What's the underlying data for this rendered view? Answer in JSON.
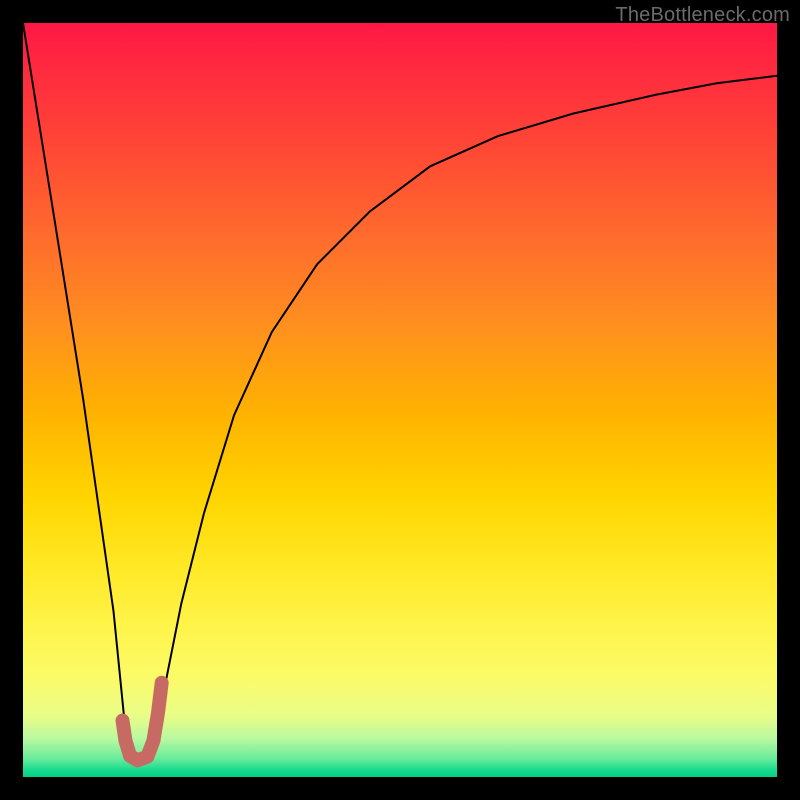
{
  "watermark": "TheBottleneck.com",
  "chart_data": {
    "type": "line",
    "title": "",
    "xlabel": "",
    "ylabel": "",
    "xlim": [
      0,
      100
    ],
    "ylim": [
      0,
      100
    ],
    "grid": false,
    "legend": false,
    "series": [
      {
        "name": "descent",
        "color": "#000000",
        "width": 2,
        "x": [
          0,
          4,
          8,
          12,
          13.5,
          14.2
        ],
        "values": [
          100,
          75,
          50,
          22,
          7,
          2
        ]
      },
      {
        "name": "curve",
        "color": "#000000",
        "width": 2,
        "x": [
          17.5,
          19,
          21,
          24,
          28,
          33,
          39,
          46,
          54,
          63,
          73,
          84,
          92,
          100
        ],
        "values": [
          5,
          13,
          23,
          35,
          48,
          59,
          68,
          75,
          81,
          85,
          88,
          90.5,
          92,
          93
        ]
      },
      {
        "name": "J-stroke",
        "color": "#c86a64",
        "width": 14,
        "linecap": "round",
        "x": [
          13.2,
          13.6,
          14.2,
          15.2,
          16.5,
          17.3,
          17.9,
          18.4
        ],
        "values": [
          7.5,
          4.8,
          2.8,
          2.2,
          2.7,
          4.8,
          8.5,
          12.5
        ]
      }
    ]
  }
}
